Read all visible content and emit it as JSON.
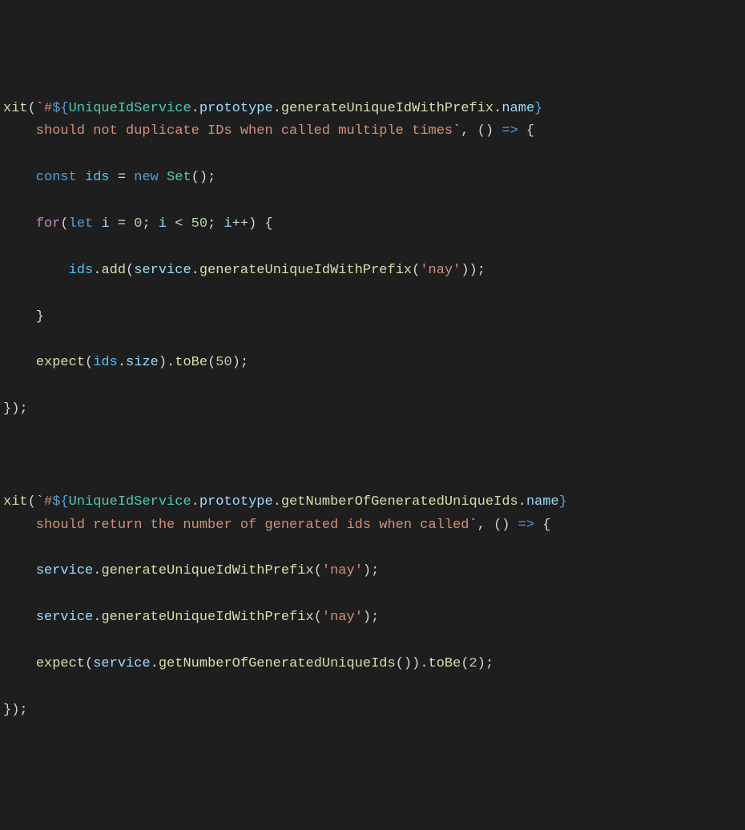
{
  "code": {
    "t1": {
      "xit": "xit",
      "bt1": "(`",
      "hash": "#",
      "dol1": "${",
      "cls": "UniqueIdService",
      "dot": ".",
      "proto": "prototype",
      "genFn": "generateUniqueIdWithPrefix",
      "name": "name",
      "cb1": "}",
      "desc": "\n    should not duplicate IDs when called multiple times",
      "bt2": "`, () ",
      "arrow": "=>",
      "ob": " {",
      "l_const": "    const ",
      "ids": "ids",
      "eq": " = ",
      "new": "new ",
      "Set": "Set",
      "setP": "();",
      "l_for": "    for",
      "forO": "(",
      "let": "let ",
      "i": "i",
      "ieq": " = ",
      "z0": "0",
      "sc": "; ",
      "lt": " < ",
      "fifty": "50",
      "ipp": "++) {",
      "l_add": "        ",
      "addIds": "ids",
      "addDot": ".",
      "add": "add",
      "addO": "(",
      "svc": "service",
      "gen": "generateUniqueIdWithPrefix",
      "nay": "'nay'",
      "cAdd": "));",
      "cFor": "    }",
      "l_exp": "    ",
      "expect": "expect",
      "expO": "(",
      "size": "size",
      "expC": ").",
      "toBe": "toBe",
      "toBeO": "(",
      "fifty2": "50",
      "toBeC": ");",
      "close": "});"
    },
    "t2": {
      "xit": "xit",
      "bt1": "(`",
      "hash": "#",
      "dol1": "${",
      "cls": "UniqueIdService",
      "dot": ".",
      "proto": "prototype",
      "getFn": "getNumberOfGeneratedUniqueIds",
      "name": "name",
      "cb1": "}",
      "desc": "\n    should return the number of generated ids when called",
      "bt2": "`, () ",
      "arrow": "=>",
      "ob": " {",
      "l_svc": "    ",
      "svc": "service",
      "gen": "generateUniqueIdWithPrefix",
      "nay": "'nay'",
      "sc": ");",
      "expect": "expect",
      "getN": "getNumberOfGeneratedUniqueIds",
      "call": "()).",
      "toBe": "toBe",
      "two": "2",
      "toBeC": ");",
      "close": "});"
    }
  }
}
